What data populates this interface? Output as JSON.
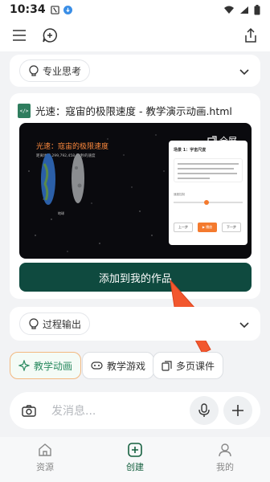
{
  "status": {
    "time": "10:34"
  },
  "header": {
    "menu_icon": "menu-icon",
    "chat_icon": "new-chat-icon",
    "share_icon": "share-icon"
  },
  "thinking": {
    "label": "专业思考"
  },
  "file": {
    "title": "光速：寇宙的极限速度 - 教学演示动画.html",
    "icon_text": "</>"
  },
  "preview": {
    "title": "光速：寇宙的极限速度",
    "subtitle": "距离地球 299,792,458 米/秒的速度",
    "fullscreen": "全屏",
    "earth_label": "地球",
    "scene_title": "场景 1：宇宙尺度",
    "prev": "上一步",
    "play": "▶ 播放",
    "next": "下一步",
    "speed_label": "速度控制"
  },
  "actions": {
    "add_to_works": "添加到我的作品"
  },
  "process": {
    "label": "过程输出"
  },
  "chips": [
    {
      "label": "教学动画"
    },
    {
      "label": "教学游戏"
    },
    {
      "label": "多页课件"
    }
  ],
  "composer": {
    "placeholder": "发消息..."
  },
  "tabs": [
    {
      "label": "资源"
    },
    {
      "label": "创建"
    },
    {
      "label": "我的"
    }
  ],
  "colors": {
    "primary": "#0f4a3f",
    "accent": "#2a8a60",
    "arrow": "#f2572e",
    "preview_title": "#ff8a3d"
  }
}
